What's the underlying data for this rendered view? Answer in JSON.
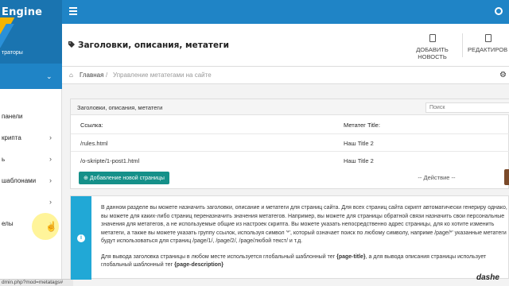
{
  "topbar": {
    "brand": "Engine"
  },
  "sidebar": {
    "header_text": "траторы",
    "items": [
      {
        "label": "панели",
        "arrow": ""
      },
      {
        "label": "крипта",
        "arrow": "›"
      },
      {
        "label": "ь",
        "arrow": "›"
      },
      {
        "label": "шаблонами",
        "arrow": "›"
      },
      {
        "label": "",
        "arrow": "›"
      },
      {
        "label": "елы",
        "arrow": "›"
      }
    ],
    "status_url": "dmin.php?mod=metatags#"
  },
  "header": {
    "title": "Заголовки, описания, метатеги",
    "add_news_label": "ДОБАВИТЬ НОВОСТЬ",
    "edit_label": "РЕДАКТИРОВ"
  },
  "breadcrumb": {
    "home": "Главная",
    "separator": "/",
    "current": "Управление метатегами на сайте"
  },
  "panel": {
    "title": "Заголовки, описания, метатеги",
    "search_placeholder": "Поиск",
    "columns": [
      "Ссылка:",
      "Метатег Title:"
    ],
    "rows": [
      {
        "link": "/rules.html",
        "title": "Наш Title 2"
      },
      {
        "link": "/o-skripte/1-post1.html",
        "title": "Наш Title 2"
      }
    ],
    "add_button": "Добавление новой страницы",
    "action_select": "-- Действие --"
  },
  "info": {
    "paragraph1": "В данном разделе вы можете назначить заголовки, описание и метатеги для страниц сайта. Для всех страниц сайта скрипт автоматически генериру однако, вы можете для каких-либо страниц переназначить значения метатегов. Например, вы можете для страницы обратной связи назначить свои персональные значения для метатегов, а не используемые общие из настроек скрипта. Вы можете указать непосредственно адрес страницы, для ко хотите изменить метатеги, а также вы можете указать группу ссылок, используя символ '*', который означает поиск по любому символу, наприме /page/*' указанные метатеги будут использоваться для страниц /page/1/, /page/2/, /page/любой текст/ и т.д.",
    "paragraph2_pre": "Для вывода заголовка страницы в любом месте используется глобальный шаблонный тег ",
    "paragraph2_tag1": "{page-title}",
    "paragraph2_mid": ", а для вывода описания страницы использует глобальный шаблонный тег ",
    "paragraph2_tag2": "{page-description}"
  },
  "watermark": "dashe",
  "colors": {
    "topbar": "#1f84c6",
    "accent": "#f5b400",
    "info": "#21a8d6",
    "add_button": "#159089"
  }
}
